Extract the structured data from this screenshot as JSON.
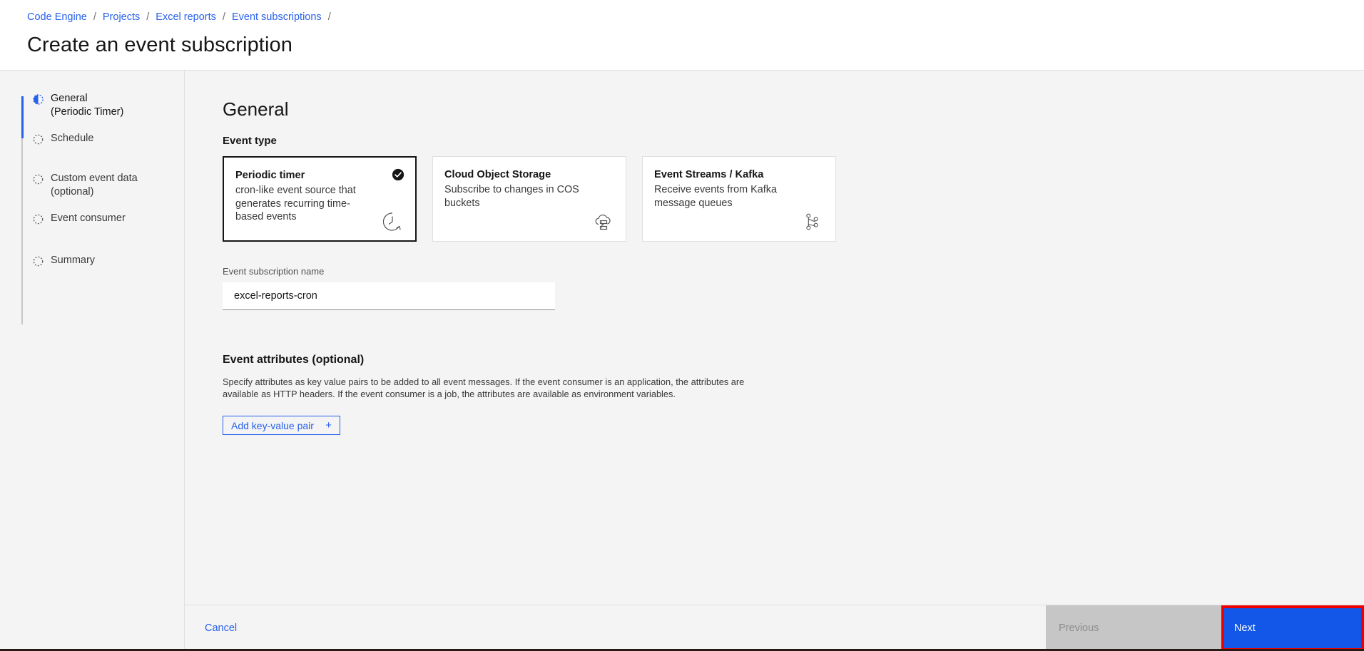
{
  "breadcrumb": {
    "items": [
      {
        "label": "Code Engine"
      },
      {
        "label": "Projects"
      },
      {
        "label": "Excel reports"
      },
      {
        "label": "Event subscriptions"
      }
    ],
    "separator": "/"
  },
  "header": {
    "title": "Create an event subscription"
  },
  "sidebar": {
    "steps": [
      {
        "label": "General\n(Periodic Timer)",
        "state": "active",
        "icon": "half-filled-circle-icon"
      },
      {
        "label": "Schedule",
        "state": "incomplete",
        "icon": "dashed-circle-icon"
      },
      {
        "label": "Custom event data\n(optional)",
        "state": "incomplete",
        "icon": "dashed-circle-icon"
      },
      {
        "label": "Event consumer",
        "state": "incomplete",
        "icon": "dashed-circle-icon"
      },
      {
        "label": "Summary",
        "state": "incomplete",
        "icon": "dashed-circle-icon"
      }
    ]
  },
  "main": {
    "section_title": "General",
    "event_type_label": "Event type",
    "cards": [
      {
        "title": "Periodic timer",
        "desc": "cron-like event source that generates recurring time-based events",
        "selected": true,
        "icon": "clock-recurring-icon"
      },
      {
        "title": "Cloud Object Storage",
        "desc": "Subscribe to changes in COS buckets",
        "selected": false,
        "icon": "cloud-storage-icon"
      },
      {
        "title": "Event Streams / Kafka",
        "desc": "Receive events from Kafka message queues",
        "selected": false,
        "icon": "node-graph-icon"
      }
    ],
    "name_field": {
      "label": "Event subscription name",
      "value": "excel-reports-cron",
      "placeholder": ""
    },
    "attributes": {
      "title": "Event attributes (optional)",
      "description": "Specify attributes as key value pairs to be added to all event messages. If the event consumer is an application, the attributes are available as HTTP headers. If the event consumer is a job, the attributes are available as environment variables.",
      "add_button_label": "Add key-value pair",
      "add_button_icon": "plus-icon"
    }
  },
  "footer": {
    "cancel_label": "Cancel",
    "previous_label": "Previous",
    "next_label": "Next"
  },
  "colors": {
    "accent_blue": "#2660ec",
    "next_button_blue": "#1257e8",
    "highlight_red": "#ee0000",
    "disabled_gray": "#c6c6c6"
  }
}
